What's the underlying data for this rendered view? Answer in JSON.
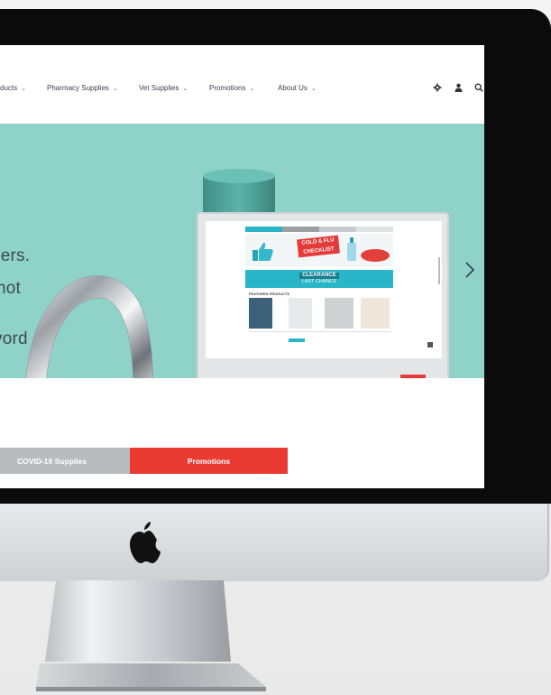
{
  "nav": {
    "items": [
      {
        "label": "ducts"
      },
      {
        "label": "Pharmacy Supplies"
      },
      {
        "label": "Vet Supplies"
      },
      {
        "label": "Promotions"
      },
      {
        "label": "About Us"
      }
    ],
    "icons": [
      "settings-icon",
      "user-icon",
      "search-icon"
    ]
  },
  "hero": {
    "lines": [
      "ders.",
      "not",
      "vord"
    ],
    "background": "#8fd3c8"
  },
  "mini_screen": {
    "tabs": [
      "",
      "",
      "",
      ""
    ],
    "banner_text": "COLD & FLU CHECKLIST",
    "clearance_text": "CLEARANCE",
    "clearance_sub": "LAST CHANCE",
    "section_title": "FEATURED PRODUCTS"
  },
  "buttons": {
    "covid": "COVID-19 Supplies",
    "promo": "Promotions"
  },
  "colors": {
    "accent_red": "#ea3b33",
    "teal": "#8fd3c8",
    "dot_blue": "#1f7fb8"
  }
}
